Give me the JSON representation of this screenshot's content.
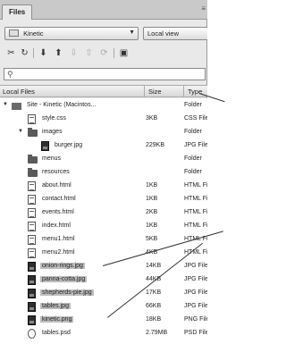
{
  "panel": {
    "tab_label": "Files",
    "tab_menu": "≡"
  },
  "site_select": {
    "value": "Kinetic"
  },
  "view_select": {
    "value": "Local view"
  },
  "search": {
    "placeholder": ""
  },
  "columns": {
    "name": "Local Files",
    "size": "Size",
    "type": "Type"
  },
  "files": [
    {
      "name": "Site - Kinetic (Macintos...",
      "size": "",
      "type": "Folder"
    },
    {
      "name": "style.css",
      "size": "3KB",
      "type": "CSS File"
    },
    {
      "name": "images",
      "size": "",
      "type": "Folder"
    },
    {
      "name": "burger.jpg",
      "size": "229KB",
      "type": "JPG File"
    },
    {
      "name": "menus",
      "size": "",
      "type": "Folder"
    },
    {
      "name": "resources",
      "size": "",
      "type": "Folder"
    },
    {
      "name": "about.html",
      "size": "1KB",
      "type": "HTML File"
    },
    {
      "name": "contact.html",
      "size": "1KB",
      "type": "HTML File"
    },
    {
      "name": "events.html",
      "size": "2KB",
      "type": "HTML File"
    },
    {
      "name": "index.html",
      "size": "1KB",
      "type": "HTML File"
    },
    {
      "name": "menu1.html",
      "size": "5KB",
      "type": "HTML File"
    },
    {
      "name": "menu2.html",
      "size": "4KB",
      "type": "HTML File"
    },
    {
      "name": "onion-rings.jpg",
      "size": "14KB",
      "type": "JPG File"
    },
    {
      "name": "panna-cotta.jpg",
      "size": "44KB",
      "type": "JPG File"
    },
    {
      "name": "shepherds-pie.jpg",
      "size": "17KB",
      "type": "JPG File"
    },
    {
      "name": "tables.jpg",
      "size": "66KB",
      "type": "JPG File"
    },
    {
      "name": "kinetic.png",
      "size": "18KB",
      "type": "PNG File"
    },
    {
      "name": "tables.psd",
      "size": "2.79MB",
      "type": "PSD File"
    }
  ],
  "icons": {
    "refresh": "refresh-icon",
    "get": "down-arrow-icon",
    "put": "up-arrow-icon",
    "connect": "connect-icon"
  }
}
